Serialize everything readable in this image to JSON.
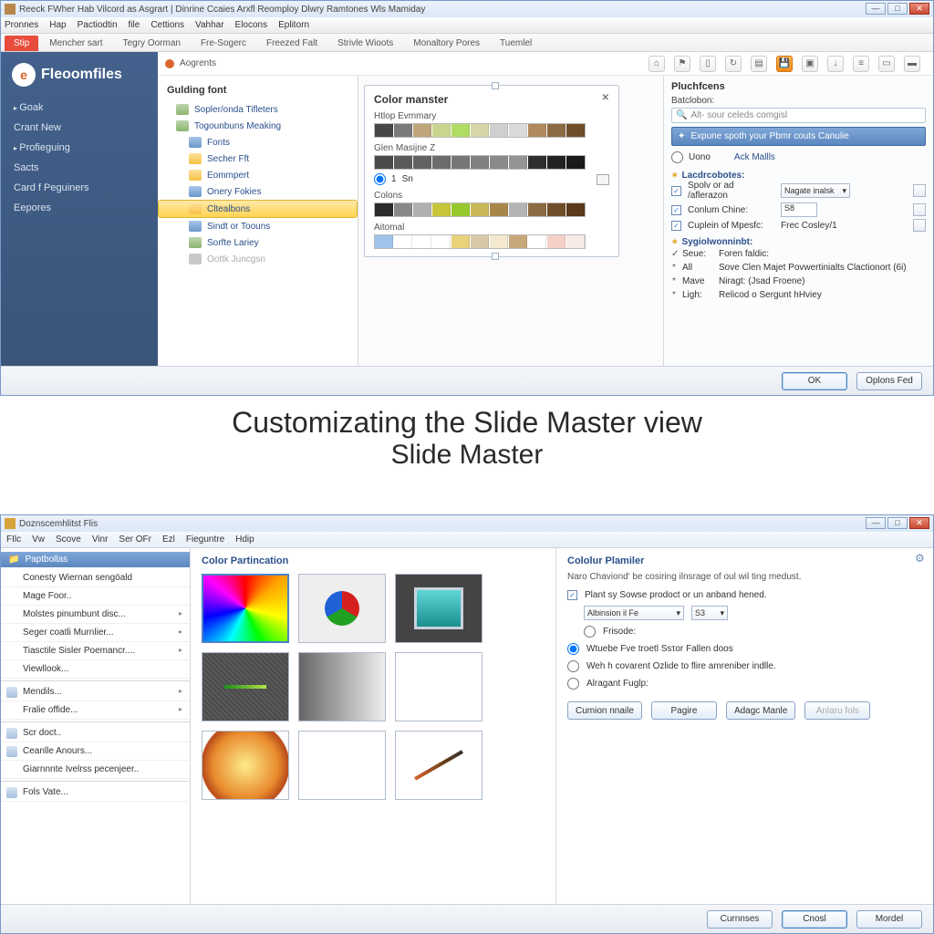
{
  "win1": {
    "title": "Reeck FWher Hab Vilcord as Asgrart | Dinrine Ccaies Arxfl Reomploy Dlwry Ramtones Wls Mamiday",
    "menubar": [
      "Pronnes",
      "Hap",
      "Pactiodtin",
      "file",
      "Cettions",
      "Vahhar",
      "Elocons",
      "Eplitorn"
    ],
    "tabs": [
      "Stip",
      "Mencher sart",
      "Tegry Oorman",
      "Fre-Sogerc",
      "Freezed Falt",
      "Strivle Wioots",
      "Monaltory Pores",
      "Tuemlel"
    ],
    "brand": "Fleoomfiles",
    "sidebar": [
      "Goak",
      "Crant New",
      "Profieguing",
      "Sacts",
      "Card f Peguiners",
      "Eepores"
    ],
    "toolbar_label": "Aogrents",
    "tree_head": "Gulding font",
    "tree": [
      "Sopler/onda Tifleters",
      "Togounbuns Meaking",
      "Fonts",
      "Secher Fft",
      "Eommpert",
      "Onery Fokies",
      "Cltealbons",
      "Sindt or Toouns",
      "Sorfte Lariey",
      "Oottk Juncgsn"
    ],
    "panel": {
      "title": "Color manster",
      "labels": [
        "Htlop Evmmary",
        "Glen Masijne  Z",
        "Colons",
        "Aitomal"
      ],
      "radio_val": "1",
      "radio_lbl": "Sn",
      "swatches1": [
        "#474747",
        "#7a7a7a",
        "#bfa67a",
        "#c9d68f",
        "#b0dc64",
        "#d6d6a8",
        "#cfcfcf",
        "#dadada",
        "#b08a5e",
        "#8c6a42",
        "#704e2a"
      ],
      "swatches2": [
        "#4a4a4a",
        "#5a5a5a",
        "#626262",
        "#6c6c6c",
        "#767676",
        "#808080",
        "#8a8a8a",
        "#949494",
        "#2e2e2e",
        "#222222",
        "#1a1a1a"
      ],
      "swatches3": [
        "#2a2a2a",
        "#888888",
        "#b0b0b0",
        "#c7c53a",
        "#97c82e",
        "#c9b85a",
        "#a8864a",
        "#b4b4b4",
        "#8c6a42",
        "#704e2a",
        "#5a3a1a"
      ],
      "swatches4": [
        "#9fc4ea",
        "#ffffff",
        "#ffffff",
        "#ffffff",
        "#e8d27a",
        "#d8c8a8",
        "#f4e8d0",
        "#c8a87a",
        "#ffffff",
        "#f4d0c8",
        "#f8eae4"
      ]
    },
    "rc": {
      "head": "Pluchfcens",
      "batch": "Batclobon:",
      "search_ph": "Alt- sour celeds comgisl",
      "bluebar": "Expune spoth your Pbmr couts Canulie",
      "row_radio": "Uono",
      "row_link": "Ack Mallls",
      "sect1": "Lacdrcobotes:",
      "g1": [
        {
          "c": true,
          "a": "Spolv or ad /aflerazon",
          "b": "Nagate inalsk",
          "t": "select"
        },
        {
          "c": true,
          "a": "Conlum Chine:",
          "b": "S8",
          "t": "input"
        },
        {
          "c": true,
          "a": "Cuplein of Mpesfc:",
          "b": "Frec Cosley/1",
          "t": "text"
        }
      ],
      "sect2": "Sygiolwonninbt:",
      "g2": [
        {
          "p": "✓",
          "a": "Seue:",
          "b": "Foren faldic:"
        },
        {
          "p": "*",
          "a": "All",
          "b": "Sove Clen Majet Povwertinialts Clactionort (6i)"
        },
        {
          "p": "*",
          "a": "Mave",
          "b": "Niragt:            (Jsad Froene)"
        },
        {
          "p": "*",
          "a": "Ligh:",
          "b": "Relicod o Sergunt hHviey"
        }
      ]
    },
    "footer": {
      "ok": "OK",
      "opt": "Oplons Fed"
    }
  },
  "caption": {
    "l1": "Customizating the Slide Master view",
    "l2": "Slide Master"
  },
  "win2": {
    "title": "Doznscemhlitst Flis",
    "menubar": [
      "FIlc",
      "Vw",
      "Scove",
      "Vinr",
      "Ser OFr",
      "Ezl",
      "Fieguntre",
      "Hdip"
    ],
    "side_head": "Paptbollas",
    "side": [
      {
        "t": "Conesty Wiernan sengöald",
        "a": false
      },
      {
        "t": "Mage Foor..",
        "a": false
      },
      {
        "t": "Molstes pinumbunt disc...",
        "a": true
      },
      {
        "t": "Seger coatli Murnlier...",
        "a": true
      },
      {
        "t": "Tiasctile Sisler Poemancr....",
        "a": true
      },
      {
        "t": "Viewllook...",
        "a": false
      },
      {
        "t": "Mendils...",
        "a": true,
        "i": true,
        "sep": true
      },
      {
        "t": "Fralie offide...",
        "a": true
      },
      {
        "t": "Scr doct..",
        "a": false,
        "i": true,
        "sep": true
      },
      {
        "t": "Ceanlle Anours...",
        "a": false,
        "i": true
      },
      {
        "t": "Giarnnnte Ivelrss pecenjeer..",
        "a": false
      },
      {
        "t": "Fols Vate...",
        "a": false,
        "i": true,
        "sep": true
      }
    ],
    "grid_head": "Color Partincation",
    "r2": {
      "head": "Cololur Plamiler",
      "desc": "Naro Chaviond' be cosiring ilnsrage of oul wil ting medust.",
      "chk": "Plant sy Sowse prodoct or un anband hened.",
      "sel": "Albinsion il Fe",
      "selnum": "S3",
      "rad1": "Frisode:",
      "rad2": "Wtuebe Fve troetl Ssτor Fallen doos",
      "rad3": "Weh h covarent Ozlide to flire amreniber indlle.",
      "rad4": "Alragant Fuglp:",
      "btns": [
        "Cumion nnaile",
        "Pagire",
        "Adagc Manle",
        "Anlaru fols"
      ]
    },
    "footer": [
      "Curnnses",
      "Cnosl",
      "Mordel"
    ]
  }
}
